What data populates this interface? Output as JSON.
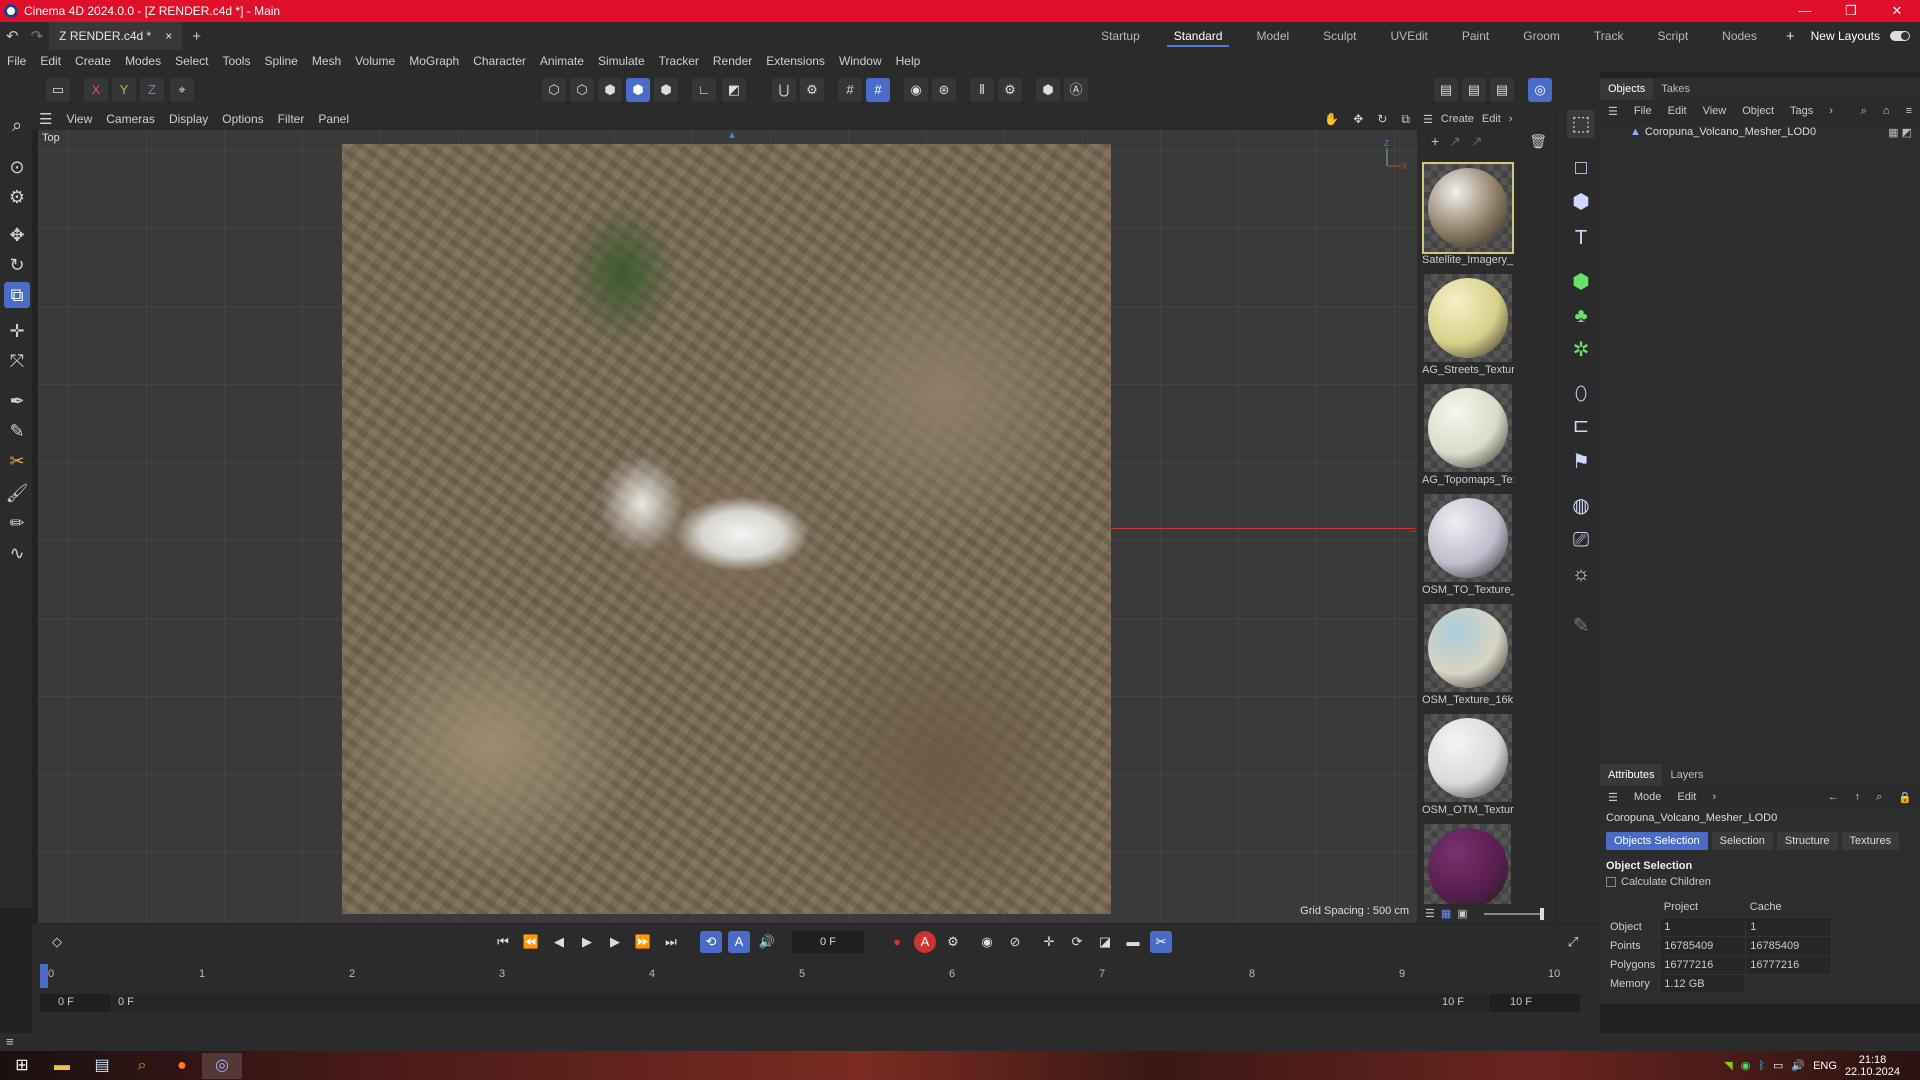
{
  "title": {
    "text": "Cinema 4D 2024.0.0 - [Z RENDER.c4d *] - Main"
  },
  "doc_tab": {
    "label": "Z RENDER.c4d *",
    "close": "×",
    "add": "+"
  },
  "layouts": [
    "Startup",
    "Standard",
    "Model",
    "Sculpt",
    "UVEdit",
    "Paint",
    "Groom",
    "Track",
    "Script",
    "Nodes"
  ],
  "layouts_active": "Standard",
  "new_layouts": "New Layouts",
  "menu": [
    "File",
    "Edit",
    "Create",
    "Modes",
    "Select",
    "Tools",
    "Spline",
    "Mesh",
    "Volume",
    "MoGraph",
    "Character",
    "Animate",
    "Simulate",
    "Tracker",
    "Render",
    "Extensions",
    "Window",
    "Help"
  ],
  "axis_locks": {
    "x": "X",
    "y": "Y",
    "z": "Z"
  },
  "viewport_menu": [
    "View",
    "Cameras",
    "Display",
    "Options",
    "Filter",
    "Panel"
  ],
  "viewport": {
    "label": "Top",
    "grid_spacing": "Grid Spacing : 500 cm"
  },
  "material_menu": {
    "create": "Create",
    "edit": "Edit"
  },
  "materials": [
    {
      "name": "Satellite_Imagery_",
      "color": "#8a7a62",
      "highlight": "#f2f0ec"
    },
    {
      "name": "AG_Streets_Textur",
      "color": "#d8d08a",
      "highlight": "#f4f0c8"
    },
    {
      "name": "AG_Topomaps_Te:",
      "color": "#d8dcc8",
      "highlight": "#f6f6ee"
    },
    {
      "name": "OSM_TO_Texture_",
      "color": "#c0bccc",
      "highlight": "#f0eef4"
    },
    {
      "name": "OSM_Texture_16k",
      "color": "#d8d4c4",
      "highlight": "#a8ccd8"
    },
    {
      "name": "OSM_OTM_Textur",
      "color": "#d8dcd8",
      "highlight": "#f4f4f4"
    },
    {
      "name": "",
      "color": "#5a1e50",
      "highlight": "#7a3070"
    }
  ],
  "objects_panel": {
    "tabs": [
      "Objects",
      "Takes"
    ],
    "menu": [
      "File",
      "Edit",
      "View",
      "Object",
      "Tags"
    ],
    "object_name": "Coropuna_Volcano_Mesher_LOD0"
  },
  "attributes": {
    "tabs": [
      "Attributes",
      "Layers"
    ],
    "menu": [
      "Mode",
      "Edit"
    ],
    "object_name": "Coropuna_Volcano_Mesher_LOD0",
    "buttons": [
      "Objects Selection",
      "Selection",
      "Structure",
      "Textures"
    ],
    "section": "Object Selection",
    "checkbox": "Calculate Children",
    "col_project": "Project",
    "col_cache": "Cache",
    "rows": [
      {
        "label": "Object",
        "project": "1",
        "cache": "1"
      },
      {
        "label": "Points",
        "project": "16785409",
        "cache": "16785409"
      },
      {
        "label": "Polygons",
        "project": "16777216",
        "cache": "16777216"
      },
      {
        "label": "Memory",
        "project": "1.12 GB",
        "cache": ""
      }
    ]
  },
  "timeline": {
    "current_frame": "0 F",
    "ruler": [
      "0",
      "1",
      "2",
      "3",
      "4",
      "5",
      "6",
      "7",
      "8",
      "9",
      "10"
    ],
    "range_start": "0 F",
    "range_start2": "0 F",
    "range_end": "10 F",
    "range_end2": "10 F"
  },
  "taskbar": {
    "lang": "ENG",
    "time": "21:18",
    "date": "22.10.2024"
  },
  "colors": {
    "accent": "#4a6cc8",
    "title_bar": "#e0102a"
  }
}
